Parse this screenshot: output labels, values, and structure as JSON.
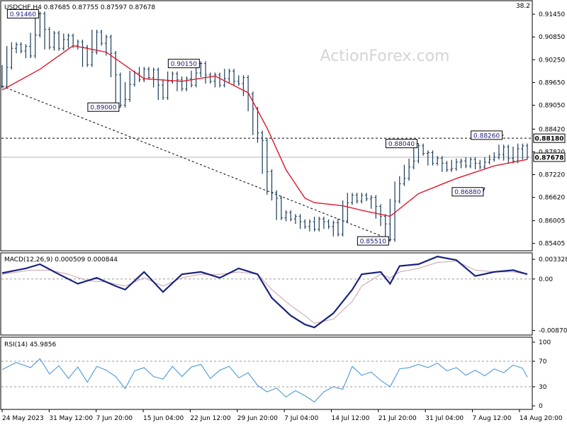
{
  "chart_data": [
    {
      "type": "line",
      "panel": "price",
      "header": "USDCHF,H4  0.87685 0.87755 0.87597 0.87678",
      "watermark": "ActionForex.com",
      "corner_value": "38.2",
      "ylim": [
        0.8525,
        0.9175
      ],
      "y_ticks": [
        "0.91450",
        "0.90850",
        "0.90250",
        "0.89650",
        "0.89050",
        "0.88420",
        "0.87820",
        "0.87220",
        "0.86620",
        "0.86005",
        "0.85405"
      ],
      "x_ticks": [
        "24 May 2023",
        "31 May 12:00",
        "7 Jun 20:00",
        "15 Jun 04:00",
        "22 Jun 12:00",
        "29 Jun 20:00",
        "7 Jul 04:00",
        "14 Jul 12:00",
        "21 Jul 20:00",
        "31 Jul 04:00",
        "7 Aug 12:00",
        "14 Aug 20:00"
      ],
      "current_price_label": "0.87678",
      "current_price": 0.87678,
      "resistance_label": "0.88180",
      "resistance": 0.8818,
      "price_path": [
        [
          0,
          0.8955
        ],
        [
          1,
          0.9005
        ],
        [
          2,
          0.9055
        ],
        [
          3,
          0.9065
        ],
        [
          4,
          0.9048
        ],
        [
          5,
          0.906
        ],
        [
          6,
          0.9035
        ],
        [
          7,
          0.909
        ],
        [
          8,
          0.9146
        ],
        [
          9,
          0.9105
        ],
        [
          10,
          0.9058
        ],
        [
          11,
          0.9095
        ],
        [
          12,
          0.9055
        ],
        [
          13,
          0.9078
        ],
        [
          14,
          0.9088
        ],
        [
          15,
          0.9062
        ],
        [
          16,
          0.9072
        ],
        [
          17,
          0.9058
        ],
        [
          18,
          0.9012
        ],
        [
          19,
          0.9045
        ],
        [
          20,
          0.9098
        ],
        [
          21,
          0.9068
        ],
        [
          22,
          0.9085
        ],
        [
          23,
          0.9042
        ],
        [
          24,
          0.8985
        ],
        [
          25,
          0.8905
        ],
        [
          26,
          0.892
        ],
        [
          27,
          0.896
        ],
        [
          28,
          0.899
        ],
        [
          29,
          0.8972
        ],
        [
          30,
          0.9
        ],
        [
          31,
          0.8978
        ],
        [
          32,
          0.8998
        ],
        [
          33,
          0.8958
        ],
        [
          34,
          0.8925
        ],
        [
          35,
          0.8968
        ],
        [
          36,
          0.8988
        ],
        [
          37,
          0.8972
        ],
        [
          38,
          0.8948
        ],
        [
          39,
          0.8975
        ],
        [
          40,
          0.8958
        ],
        [
          41,
          0.899
        ],
        [
          42,
          0.9015
        ],
        [
          43,
          0.8985
        ],
        [
          44,
          0.8968
        ],
        [
          45,
          0.8985
        ],
        [
          46,
          0.8958
        ],
        [
          47,
          0.8975
        ],
        [
          48,
          0.8995
        ],
        [
          49,
          0.8968
        ],
        [
          50,
          0.8962
        ],
        [
          51,
          0.8978
        ],
        [
          52,
          0.8935
        ],
        [
          53,
          0.8895
        ],
        [
          54,
          0.8832
        ],
        [
          55,
          0.8812
        ],
        [
          56,
          0.873
        ],
        [
          57,
          0.8675
        ],
        [
          58,
          0.866
        ],
        [
          59,
          0.8608
        ],
        [
          60,
          0.8622
        ],
        [
          61,
          0.8605
        ],
        [
          62,
          0.8612
        ],
        [
          63,
          0.8598
        ],
        [
          64,
          0.8585
        ],
        [
          65,
          0.8598
        ],
        [
          66,
          0.8578
        ],
        [
          67,
          0.8605
        ],
        [
          68,
          0.8598
        ],
        [
          69,
          0.8585
        ],
        [
          70,
          0.8595
        ],
        [
          71,
          0.8565
        ],
        [
          72,
          0.86
        ],
        [
          73,
          0.8648
        ],
        [
          74,
          0.8668
        ],
        [
          75,
          0.8652
        ],
        [
          76,
          0.8668
        ],
        [
          77,
          0.8658
        ],
        [
          78,
          0.8662
        ],
        [
          79,
          0.8638
        ],
        [
          80,
          0.8612
        ],
        [
          81,
          0.8592
        ],
        [
          82,
          0.8551
        ],
        [
          83,
          0.8652
        ],
        [
          84,
          0.8698
        ],
        [
          85,
          0.8712
        ],
        [
          86,
          0.8742
        ],
        [
          87,
          0.8758
        ],
        [
          88,
          0.8798
        ],
        [
          89,
          0.8778
        ],
        [
          90,
          0.878
        ],
        [
          91,
          0.8752
        ],
        [
          92,
          0.8765
        ],
        [
          93,
          0.8752
        ],
        [
          94,
          0.8735
        ],
        [
          95,
          0.8738
        ],
        [
          96,
          0.8755
        ],
        [
          97,
          0.8758
        ],
        [
          98,
          0.8745
        ],
        [
          99,
          0.8762
        ],
        [
          100,
          0.8752
        ],
        [
          101,
          0.8742
        ],
        [
          102,
          0.8755
        ],
        [
          103,
          0.8762
        ],
        [
          104,
          0.8768
        ],
        [
          105,
          0.8775
        ],
        [
          106,
          0.8795
        ],
        [
          107,
          0.8765
        ],
        [
          108,
          0.8758
        ],
        [
          109,
          0.879
        ],
        [
          110,
          0.8798
        ],
        [
          111,
          0.8768
        ]
      ],
      "ma_path": [
        [
          0,
          0.8945
        ],
        [
          8,
          0.9
        ],
        [
          15,
          0.9062
        ],
        [
          22,
          0.9045
        ],
        [
          30,
          0.8975
        ],
        [
          38,
          0.8968
        ],
        [
          45,
          0.8982
        ],
        [
          52,
          0.8938
        ],
        [
          56,
          0.8845
        ],
        [
          60,
          0.8735
        ],
        [
          64,
          0.866
        ],
        [
          66,
          0.8648
        ],
        [
          72,
          0.864
        ],
        [
          76,
          0.8628
        ],
        [
          82,
          0.8612
        ],
        [
          88,
          0.8672
        ],
        [
          96,
          0.8712
        ],
        [
          104,
          0.8745
        ],
        [
          111,
          0.8762
        ]
      ],
      "trendline": [
        [
          0,
          0.8955
        ],
        [
          82,
          0.8551
        ]
      ],
      "price_labels": [
        {
          "idx": 8,
          "value": 0.9146,
          "text": "0.91460"
        },
        {
          "idx": 25,
          "value": 0.89,
          "text": "0.89000"
        },
        {
          "idx": 42,
          "value": 0.9015,
          "text": "0.90150"
        },
        {
          "idx": 82,
          "value": 0.8551,
          "text": "0.85510"
        },
        {
          "idx": 88,
          "value": 0.8804,
          "text": "0.88040"
        },
        {
          "idx": 102,
          "value": 0.8688,
          "text": "0.86880"
        },
        {
          "idx": 106,
          "value": 0.8826,
          "text": "0.88260"
        }
      ]
    },
    {
      "type": "line",
      "panel": "macd",
      "header": "MACD(12,26,9) 0.000509 0.000844",
      "ylim": [
        -0.009,
        0.0037
      ],
      "y_ticks": [
        "0.003328",
        "0.00",
        "-0.008707"
      ],
      "zero_line": 0.0,
      "series": [
        {
          "values": [
            [
              0,
              0.001
            ],
            [
              5,
              0.0018
            ],
            [
              8,
              0.0025
            ],
            [
              12,
              0.0008
            ],
            [
              16,
              -0.0008
            ],
            [
              20,
              0.0002
            ],
            [
              24,
              -0.0012
            ],
            [
              26,
              -0.0018
            ],
            [
              30,
              0.0012
            ],
            [
              34,
              -0.0022
            ],
            [
              38,
              0.0008
            ],
            [
              42,
              0.0012
            ],
            [
              46,
              0.0002
            ],
            [
              50,
              0.0018
            ],
            [
              54,
              0.0008
            ],
            [
              57,
              -0.0032
            ],
            [
              61,
              -0.0062
            ],
            [
              64,
              -0.0077
            ],
            [
              66,
              -0.0082
            ],
            [
              70,
              -0.0058
            ],
            [
              74,
              -0.0018
            ],
            [
              76,
              0.0008
            ],
            [
              80,
              0.0012
            ],
            [
              82,
              -0.0008
            ],
            [
              84,
              0.0022
            ],
            [
              88,
              0.0025
            ],
            [
              92,
              0.0038
            ],
            [
              96,
              0.0032
            ],
            [
              100,
              0.0005
            ],
            [
              104,
              0.0012
            ],
            [
              108,
              0.0015
            ],
            [
              111,
              0.0008
            ]
          ]
        },
        {
          "values": [
            [
              0,
              0.0008
            ],
            [
              6,
              0.0015
            ],
            [
              10,
              0.0015
            ],
            [
              14,
              0.0008
            ],
            [
              18,
              -0.0003
            ],
            [
              22,
              -0.0005
            ],
            [
              26,
              -0.0012
            ],
            [
              30,
              0.0002
            ],
            [
              34,
              -0.0012
            ],
            [
              38,
              0.0002
            ],
            [
              42,
              0.0008
            ],
            [
              46,
              0.0008
            ],
            [
              50,
              0.0012
            ],
            [
              54,
              0.0008
            ],
            [
              57,
              -0.0018
            ],
            [
              61,
              -0.0045
            ],
            [
              64,
              -0.0062
            ],
            [
              66,
              -0.0075
            ],
            [
              70,
              -0.0068
            ],
            [
              74,
              -0.0038
            ],
            [
              76,
              -0.0012
            ],
            [
              80,
              0.0008
            ],
            [
              82,
              0.0002
            ],
            [
              84,
              0.0012
            ],
            [
              88,
              0.0018
            ],
            [
              92,
              0.0028
            ],
            [
              96,
              0.003
            ],
            [
              100,
              0.0015
            ],
            [
              104,
              0.0012
            ],
            [
              108,
              0.0012
            ],
            [
              111,
              0.0008
            ]
          ]
        }
      ]
    },
    {
      "type": "line",
      "panel": "rsi",
      "header": "RSI(14) 45.9856",
      "ylim": [
        0,
        100
      ],
      "y_ticks": [
        "100",
        "70",
        "30",
        "0"
      ],
      "levels": [
        70,
        30
      ],
      "series": [
        {
          "values": [
            [
              0,
              57
            ],
            [
              3,
              68
            ],
            [
              6,
              60
            ],
            [
              8,
              74
            ],
            [
              10,
              50
            ],
            [
              12,
              63
            ],
            [
              14,
              43
            ],
            [
              16,
              61
            ],
            [
              18,
              37
            ],
            [
              20,
              62
            ],
            [
              22,
              56
            ],
            [
              24,
              46
            ],
            [
              26,
              27
            ],
            [
              28,
              55
            ],
            [
              30,
              60
            ],
            [
              32,
              46
            ],
            [
              34,
              42
            ],
            [
              36,
              62
            ],
            [
              38,
              46
            ],
            [
              40,
              61
            ],
            [
              42,
              65
            ],
            [
              44,
              43
            ],
            [
              46,
              56
            ],
            [
              48,
              62
            ],
            [
              50,
              44
            ],
            [
              52,
              52
            ],
            [
              54,
              32
            ],
            [
              56,
              22
            ],
            [
              58,
              28
            ],
            [
              60,
              14
            ],
            [
              62,
              24
            ],
            [
              64,
              16
            ],
            [
              66,
              6
            ],
            [
              68,
              22
            ],
            [
              70,
              30
            ],
            [
              72,
              26
            ],
            [
              74,
              62
            ],
            [
              76,
              48
            ],
            [
              78,
              53
            ],
            [
              80,
              40
            ],
            [
              82,
              30
            ],
            [
              84,
              58
            ],
            [
              86,
              60
            ],
            [
              88,
              65
            ],
            [
              90,
              60
            ],
            [
              92,
              67
            ],
            [
              94,
              55
            ],
            [
              96,
              60
            ],
            [
              98,
              48
            ],
            [
              100,
              56
            ],
            [
              102,
              47
            ],
            [
              104,
              58
            ],
            [
              106,
              52
            ],
            [
              108,
              64
            ],
            [
              110,
              59
            ],
            [
              111,
              45
            ]
          ]
        }
      ]
    }
  ]
}
